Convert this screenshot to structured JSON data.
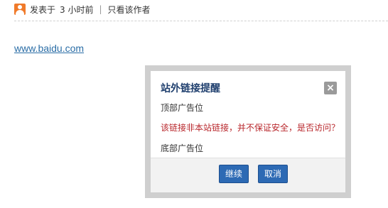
{
  "post_meta": {
    "posted_label": "发表于",
    "time_ago": "3 小时前",
    "separator": "|",
    "author_only_link": "只看该作者"
  },
  "post_body": {
    "link_text": "www.baidu.com"
  },
  "dialog": {
    "title": "站外链接提醒",
    "close_symbol": "×",
    "top_ad": "顶部广告位",
    "warning": "该链接非本站链接，并不保证安全，是否访问？",
    "bottom_ad": "底部广告位",
    "continue_label": "继续",
    "cancel_label": "取消"
  },
  "colors": {
    "title": "#1f3f6e",
    "warning": "#b8262b",
    "button": "#2d6ab4",
    "link": "#2a6da6"
  }
}
